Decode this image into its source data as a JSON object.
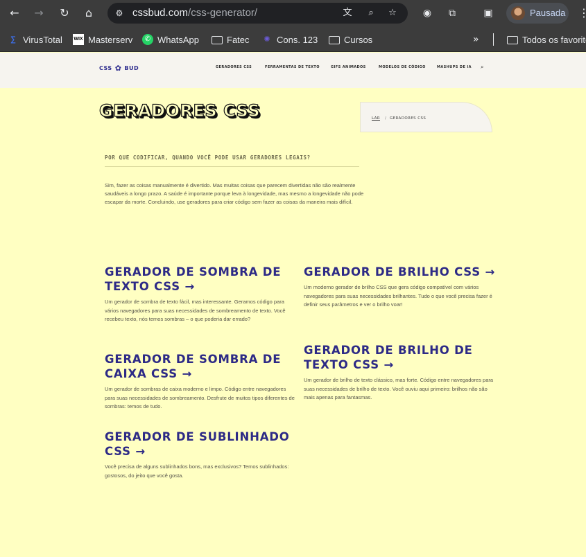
{
  "browser": {
    "url_domain": "cssbud.com",
    "url_path": "/css-generator/",
    "profile_label": "Pausada",
    "bookmarks": [
      {
        "label": "VirusTotal",
        "icon": "virustotal-icon"
      },
      {
        "label": "Masterserv",
        "icon": "wix-icon"
      },
      {
        "label": "WhatsApp",
        "icon": "whatsapp-icon"
      },
      {
        "label": "Fatec",
        "icon": "folder-icon"
      },
      {
        "label": "Cons. 123",
        "icon": "cons-icon"
      },
      {
        "label": "Cursos",
        "icon": "folder-icon"
      }
    ],
    "bookmarks_overflow": "Todos os favoritos"
  },
  "site": {
    "logo_left": "CSS",
    "logo_right": "BUD",
    "nav": [
      "GERADORES CSS",
      "FERRAMENTAS DE TEXTO",
      "GIFS ANIMADOS",
      "MODELOS DE CÓDIGO",
      "MASHUPS DE IA"
    ]
  },
  "hero": {
    "title": "GERADORES CSS",
    "breadcrumb_home": "LAR",
    "breadcrumb_sep": "/",
    "breadcrumb_current": "GERADORES CSS",
    "subheading": "POR QUE CODIFICAR, QUANDO VOCÊ PODE USAR GERADORES LEGAIS?",
    "intro": "Sim, fazer as coisas manualmente é divertido. Mas muitas coisas que parecem divertidas não são realmente saudáveis a longo prazo. A saúde é importante porque leva à longevidade, mas mesmo a longevidade não pode escapar da morte. Concluindo, use geradores para criar código sem fazer as coisas da maneira mais difícil."
  },
  "cards": [
    {
      "title": "GERADOR DE SOMBRA DE TEXTO CSS →",
      "desc": "Um gerador de sombra de texto fácil, mas interessante. Geramos código para vários navegadores para suas necessidades de sombreamento de texto. Você recebeu texto, nós temos sombras – o que poderia dar errado?"
    },
    {
      "title": "GERADOR DE BRILHO CSS →",
      "desc": "Um moderno gerador de brilho CSS que gera código compatível com vários navegadores para suas necessidades brilhantes. Tudo o que você precisa fazer é definir seus parâmetros e ver o brilho voar!"
    },
    {
      "title": "GERADOR DE SOMBRA DE CAIXA CSS →",
      "desc": "Um gerador de sombras de caixa moderno e limpo. Código entre navegadores para suas necessidades de sombreamento. Desfrute de muitos tipos diferentes de sombras: temos de tudo."
    },
    {
      "title": "GERADOR DE BRILHO DE TEXTO CSS →",
      "desc": "Um gerador de brilho de texto clássico, mas forte. Código entre navegadores para suas necessidades de brilho de texto. Você ouviu aqui primeiro: brilhos não são mais apenas para fantasmas."
    },
    {
      "title": "GERADOR DE SUBLINHADO CSS →",
      "desc": "Você precisa de alguns sublinhados bons, mas exclusivos? Temos sublinhados: gostosos, do jeito que você gosta."
    }
  ],
  "colors": {
    "page_bg": "#ffffc2",
    "header_bg": "#f6f4ef",
    "accent": "#2d2a86",
    "browser_chrome": "#3c3c3c"
  }
}
